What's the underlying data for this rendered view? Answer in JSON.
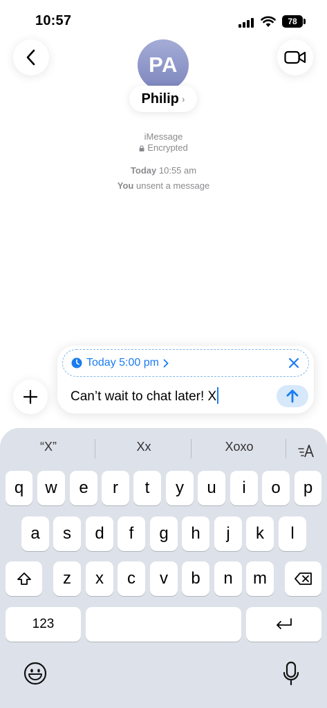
{
  "status_bar": {
    "time": "10:57",
    "battery": "78"
  },
  "header": {
    "avatar_initials": "PA",
    "contact_name": "Philip",
    "name_chevron": "›"
  },
  "conversation": {
    "service": "iMessage",
    "encryption": "Encrypted",
    "timestamp_day": "Today",
    "timestamp_time": "10:55 am",
    "event_actor": "You",
    "event_text": "unsent a message"
  },
  "composer": {
    "scheduled_label": "Today 5:00 pm",
    "text": "Can’t wait to chat later! X"
  },
  "keyboard": {
    "suggestions": [
      "“X”",
      "Xx",
      "Xoxo"
    ],
    "row1": [
      "q",
      "w",
      "e",
      "r",
      "t",
      "y",
      "u",
      "i",
      "o",
      "p"
    ],
    "row2": [
      "a",
      "s",
      "d",
      "f",
      "g",
      "h",
      "j",
      "k",
      "l"
    ],
    "row3": [
      "z",
      "x",
      "c",
      "v",
      "b",
      "n",
      "m"
    ],
    "numbers_key": "123"
  },
  "colors": {
    "accent": "#1a7cf0",
    "keyboard_bg": "#dde1ea",
    "avatar": "#8f97c9"
  }
}
